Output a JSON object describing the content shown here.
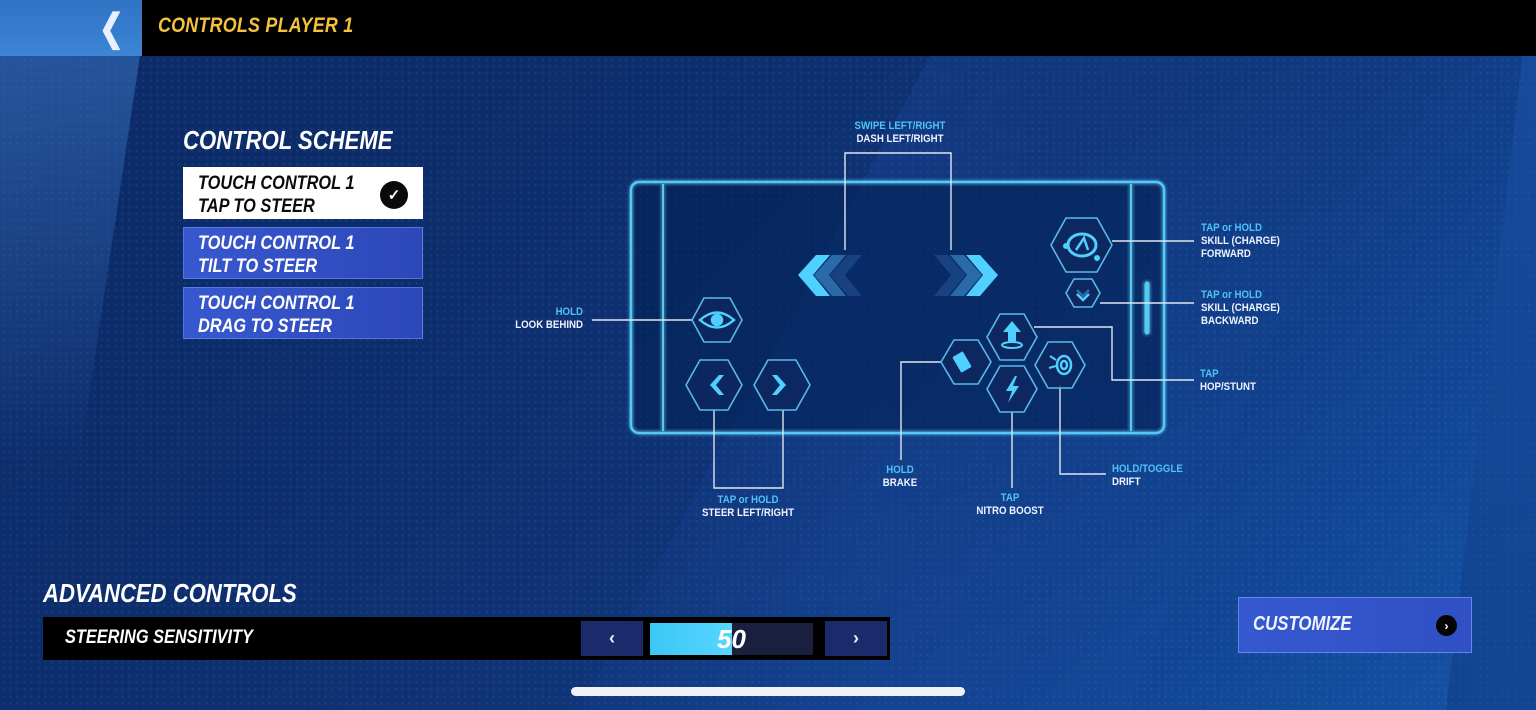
{
  "header": {
    "back_icon": "chevron-left-icon",
    "back_glyph": "❮",
    "title": "CONTROLS PLAYER 1"
  },
  "control_scheme": {
    "title": "CONTROL SCHEME",
    "options": [
      {
        "line1": "TOUCH CONTROL 1",
        "line2": "TAP TO STEER",
        "selected": true
      },
      {
        "line1": "TOUCH CONTROL 1",
        "line2": "TILT TO STEER",
        "selected": false
      },
      {
        "line1": "TOUCH CONTROL 1",
        "line2": "DRAG TO STEER",
        "selected": false
      }
    ],
    "check_glyph": "✓"
  },
  "diagram": {
    "labels": {
      "dash": {
        "action": "SWIPE LEFT/RIGHT",
        "function": "DASH LEFT/RIGHT"
      },
      "look_behind": {
        "action": "HOLD",
        "function": "LOOK BEHIND"
      },
      "skill_forward": {
        "action": "TAP or HOLD",
        "function": "SKILL (CHARGE)",
        "function2": "FORWARD"
      },
      "skill_backward": {
        "action": "TAP or HOLD",
        "function": "SKILL (CHARGE)",
        "function2": "BACKWARD"
      },
      "hop": {
        "action": "TAP",
        "function": "HOP/STUNT"
      },
      "steer": {
        "action": "TAP or HOLD",
        "function": "STEER LEFT/RIGHT"
      },
      "brake": {
        "action": "HOLD",
        "function": "BRAKE"
      },
      "nitro": {
        "action": "TAP",
        "function": "NITRO BOOST"
      },
      "drift": {
        "action": "HOLD/TOGGLE",
        "function": "DRIFT"
      }
    },
    "icons": [
      "dash-arrows-icon",
      "eye-icon",
      "steer-left-icon",
      "steer-right-icon",
      "skill-forward-icon",
      "skill-backward-icon",
      "hop-arrow-icon",
      "brake-icon",
      "nitro-bolt-icon",
      "drift-wheel-icon"
    ]
  },
  "advanced": {
    "title": "ADVANCED CONTROLS",
    "steering": {
      "label": "STEERING SENSITIVITY",
      "value": "50",
      "percent": 50,
      "decrease_glyph": "‹",
      "increase_glyph": "›"
    }
  },
  "customize": {
    "label": "CUSTOMIZE",
    "glyph": "›"
  },
  "colors": {
    "accent_yellow": "#f5c33b",
    "cyan": "#4fc3f7",
    "button_blue": "#3658d0"
  }
}
